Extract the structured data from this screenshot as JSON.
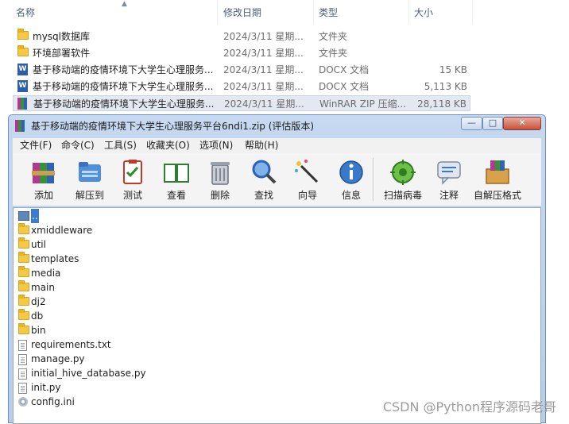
{
  "explorer": {
    "columns": {
      "name": "名称",
      "date": "修改日期",
      "type": "类型",
      "size": "大小"
    },
    "sort_icon": "sort-ascending-icon",
    "rows": [
      {
        "name": "mysql数据库",
        "date": "2024/3/11 星期...",
        "type": "文件夹",
        "size": "",
        "icon": "folder-icon"
      },
      {
        "name": "环境部署软件",
        "date": "2024/3/11 星期...",
        "type": "文件夹",
        "size": "",
        "icon": "folder-icon"
      },
      {
        "name": "基于移动端的疫情环境下大学生心理服务...",
        "date": "2024/3/11 星期...",
        "type": "DOCX 文档",
        "size": "15 KB",
        "icon": "docx-icon"
      },
      {
        "name": "基于移动端的疫情环境下大学生心理服务...",
        "date": "2024/3/11 星期...",
        "type": "DOCX 文档",
        "size": "5,113 KB",
        "icon": "docx-icon"
      },
      {
        "name": "基于移动端的疫情环境下大学生心理服务...",
        "date": "2024/3/11 星期...",
        "type": "WinRAR ZIP 压缩...",
        "size": "28,118 KB",
        "icon": "winrar-archive-icon"
      }
    ]
  },
  "winrar": {
    "title": "基于移动端的疫情环境下大学生心理服务平台6ndi1.zip (评估版本)",
    "window_controls": {
      "minimize": "—",
      "maximize": "□",
      "close": "✕"
    },
    "menu": [
      "文件(F)",
      "命令(C)",
      "工具(S)",
      "收藏夹(O)",
      "选项(N)",
      "帮助(H)"
    ],
    "toolbar": [
      {
        "label": "添加",
        "icon": "add-archive-icon"
      },
      {
        "label": "解压到",
        "icon": "extract-to-icon"
      },
      {
        "label": "测试",
        "icon": "test-icon"
      },
      {
        "label": "查看",
        "icon": "view-book-icon"
      },
      {
        "label": "删除",
        "icon": "trash-icon"
      },
      {
        "label": "查找",
        "icon": "find-magnifier-icon"
      },
      {
        "label": "向导",
        "icon": "wizard-wand-icon"
      },
      {
        "label": "信息",
        "icon": "info-icon"
      },
      {
        "label": "扫描病毒",
        "icon": "virus-scan-icon"
      },
      {
        "label": "注释",
        "icon": "comment-icon"
      },
      {
        "label": "自解压格式",
        "icon": "sfx-box-icon"
      }
    ],
    "files": [
      {
        "name": "..",
        "kind": "up"
      },
      {
        "name": "xmiddleware",
        "kind": "folder"
      },
      {
        "name": "util",
        "kind": "folder"
      },
      {
        "name": "templates",
        "kind": "folder"
      },
      {
        "name": "media",
        "kind": "folder"
      },
      {
        "name": "main",
        "kind": "folder"
      },
      {
        "name": "dj2",
        "kind": "folder"
      },
      {
        "name": "db",
        "kind": "folder"
      },
      {
        "name": "bin",
        "kind": "folder"
      },
      {
        "name": "requirements.txt",
        "kind": "file"
      },
      {
        "name": "manage.py",
        "kind": "file"
      },
      {
        "name": "initial_hive_database.py",
        "kind": "file"
      },
      {
        "name": "init.py",
        "kind": "file"
      },
      {
        "name": "config.ini",
        "kind": "ini"
      }
    ]
  },
  "watermark": "CSDN @Python程序源码老哥",
  "colors": {
    "selection": "#3d7bd1",
    "titlebar": "#c6d9f1",
    "folder": "#f5c947"
  }
}
